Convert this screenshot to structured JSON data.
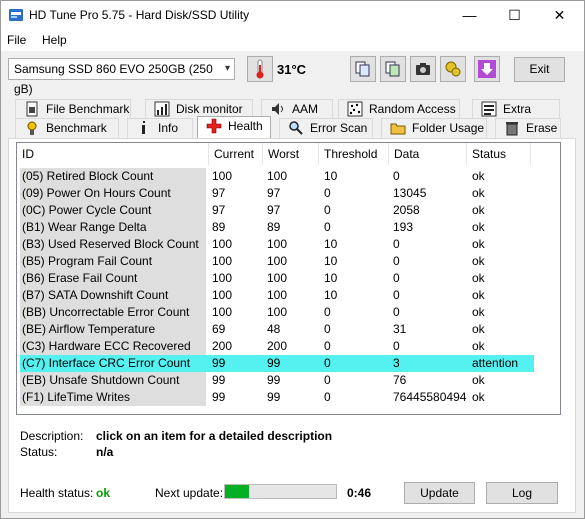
{
  "window": {
    "title": "HD Tune Pro 5.75 - Hard Disk/SSD Utility",
    "minimize": "—",
    "maximize": "☐",
    "close": "✕"
  },
  "menu": {
    "file": "File",
    "help": "Help"
  },
  "toolbar": {
    "drive": "Samsung SSD 860 EVO 250GB (250 gB)",
    "temperature": "31°C",
    "exit_label": "Exit"
  },
  "tabs_top": [
    {
      "label": "File Benchmark",
      "icon": "file-benchmark-icon"
    },
    {
      "label": "Disk monitor",
      "icon": "disk-monitor-icon"
    },
    {
      "label": "AAM",
      "icon": "speaker-icon"
    },
    {
      "label": "Random Access",
      "icon": "random-access-icon"
    },
    {
      "label": "Extra tests",
      "icon": "extra-tests-icon"
    }
  ],
  "tabs_bottom": [
    {
      "label": "Benchmark",
      "icon": "benchmark-icon"
    },
    {
      "label": "Info",
      "icon": "info-icon"
    },
    {
      "label": "Health",
      "icon": "health-cross-icon"
    },
    {
      "label": "Error Scan",
      "icon": "magnifier-icon"
    },
    {
      "label": "Folder Usage",
      "icon": "folder-icon"
    },
    {
      "label": "Erase",
      "icon": "trash-icon"
    }
  ],
  "active_tab": "Health",
  "table": {
    "headers": [
      "ID",
      "Current",
      "Worst",
      "Threshold",
      "Data",
      "Status"
    ],
    "rows": [
      [
        "(05) Retired Block Count",
        "100",
        "100",
        "10",
        "0",
        "ok"
      ],
      [
        "(09) Power On Hours Count",
        "97",
        "97",
        "0",
        "13045",
        "ok"
      ],
      [
        "(0C) Power Cycle Count",
        "97",
        "97",
        "0",
        "2058",
        "ok"
      ],
      [
        "(B1) Wear Range Delta",
        "89",
        "89",
        "0",
        "193",
        "ok"
      ],
      [
        "(B3) Used Reserved Block Count",
        "100",
        "100",
        "10",
        "0",
        "ok"
      ],
      [
        "(B5) Program Fail Count",
        "100",
        "100",
        "10",
        "0",
        "ok"
      ],
      [
        "(B6) Erase Fail Count",
        "100",
        "100",
        "10",
        "0",
        "ok"
      ],
      [
        "(B7) SATA Downshift Count",
        "100",
        "100",
        "10",
        "0",
        "ok"
      ],
      [
        "(BB) Uncorrectable Error Count",
        "100",
        "100",
        "0",
        "0",
        "ok"
      ],
      [
        "(BE) Airflow Temperature",
        "69",
        "48",
        "0",
        "31",
        "ok"
      ],
      [
        "(C3) Hardware ECC Recovered",
        "200",
        "200",
        "0",
        "0",
        "ok"
      ],
      [
        "(C7) Interface CRC Error Count",
        "99",
        "99",
        "0",
        "3",
        "attention"
      ],
      [
        "(EB) Unsafe Shutdown Count",
        "99",
        "99",
        "0",
        "76",
        "ok"
      ],
      [
        "(F1) LifeTime Writes",
        "99",
        "99",
        "0",
        "76445580494",
        "ok"
      ]
    ],
    "selected_row": 11,
    "selected_color": "#55f0f0"
  },
  "description": {
    "label": "Description:",
    "text": "click on an item for a detailed description",
    "status_label": "Status:",
    "status_value": "n/a"
  },
  "footer": {
    "health_label": "Health status:",
    "health_value": "ok",
    "health_color": "#00a000",
    "next_update_label": "Next update:",
    "progress_fraction": 0.22,
    "countdown": "0:46",
    "update_button": "Update",
    "log_button": "Log"
  }
}
